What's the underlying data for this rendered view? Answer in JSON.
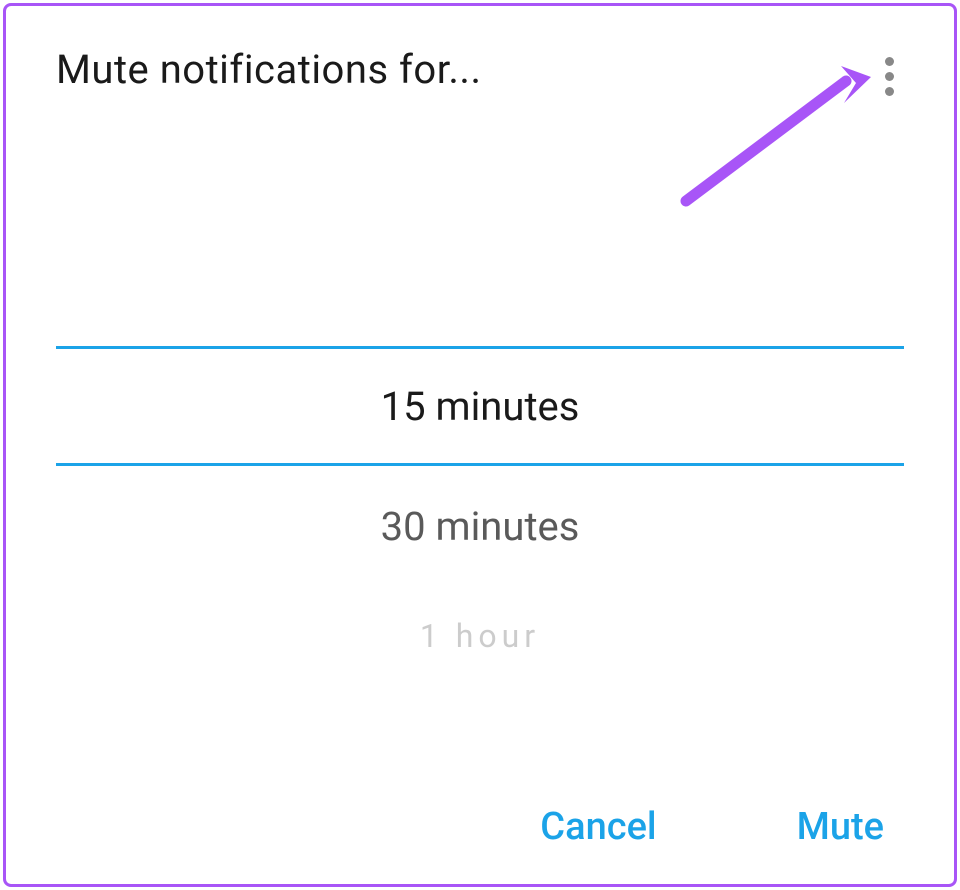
{
  "dialog": {
    "title": "Mute notifications for...",
    "picker": {
      "options": [
        "15 minutes",
        "30 minutes",
        "1 hour"
      ],
      "selected_index": 0
    },
    "buttons": {
      "cancel": "Cancel",
      "confirm": "Mute"
    }
  },
  "colors": {
    "accent": "#1ba3e8",
    "annotation": "#a855f7"
  }
}
